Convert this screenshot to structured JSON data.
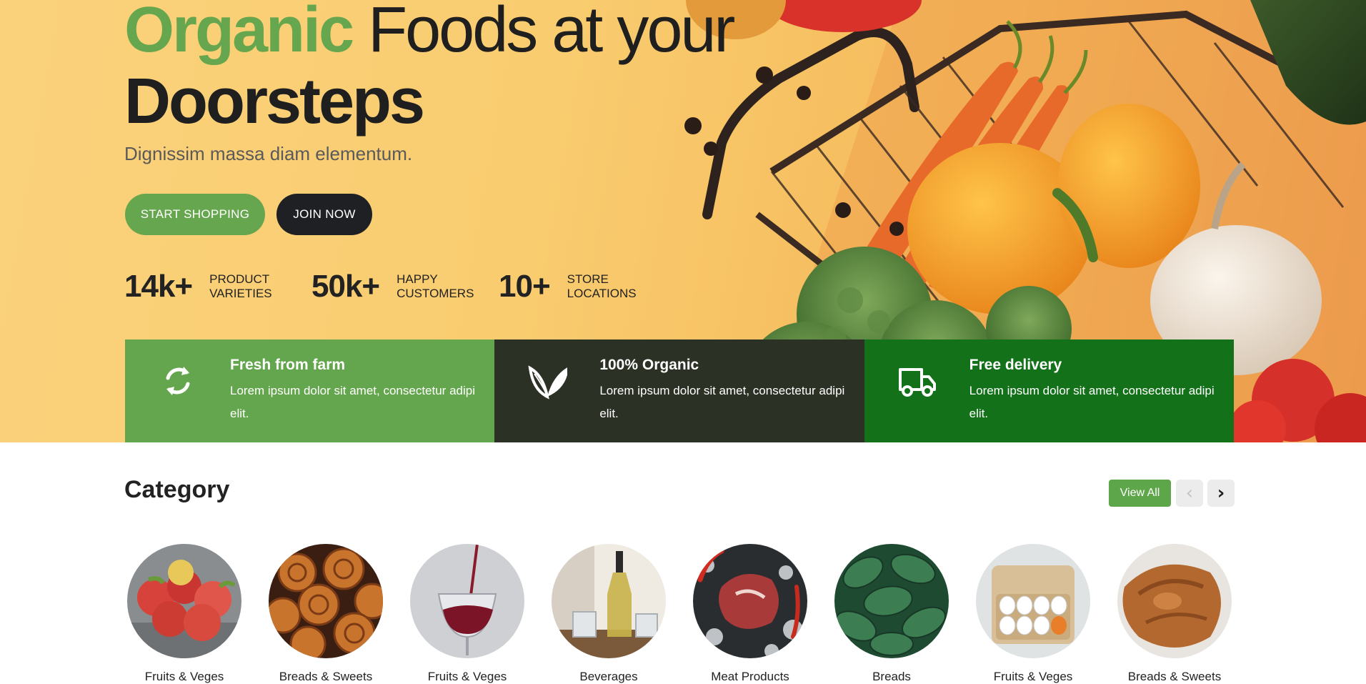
{
  "hero": {
    "title_highlight": "Organic",
    "title_rest": "Foods at your",
    "title_bold": "Doorsteps",
    "subtitle": "Dignissim massa diam elementum.",
    "btn_shop": "START SHOPPING",
    "btn_join": "JOIN NOW",
    "stats": [
      {
        "number": "14k+",
        "label_line1": "PRODUCT",
        "label_line2": "VARIETIES"
      },
      {
        "number": "50k+",
        "label_line1": "HAPPY",
        "label_line2": "CUSTOMERS"
      },
      {
        "number": "10+",
        "label_line1": "STORE",
        "label_line2": "LOCATIONS"
      }
    ]
  },
  "features": [
    {
      "icon": "refresh-icon",
      "title": "Fresh from farm",
      "text": "Lorem ipsum dolor sit amet, consectetur adipi elit.",
      "color": "#64a64d"
    },
    {
      "icon": "leaf-icon",
      "title": "100% Organic",
      "text": "Lorem ipsum dolor sit amet, consectetur adipi elit.",
      "color": "#2c3126"
    },
    {
      "icon": "truck-icon",
      "title": "Free delivery",
      "text": "Lorem ipsum dolor sit amet, consectetur adipi elit.",
      "color": "#137219"
    }
  ],
  "category": {
    "title": "Category",
    "view_all": "View All",
    "prev": "‹",
    "next": "›",
    "items": [
      {
        "label": "Fruits & Veges",
        "image": "apples"
      },
      {
        "label": "Breads & Sweets",
        "image": "cinnamon-rolls"
      },
      {
        "label": "Fruits & Veges",
        "image": "wine-glass"
      },
      {
        "label": "Beverages",
        "image": "oil-bottle"
      },
      {
        "label": "Meat Products",
        "image": "steak"
      },
      {
        "label": "Breads",
        "image": "mint-leaves"
      },
      {
        "label": "Fruits & Veges",
        "image": "eggs"
      },
      {
        "label": "Breads & Sweets",
        "image": "roast-chicken"
      }
    ]
  },
  "colors": {
    "brand_green": "#66a64e",
    "dark": "#1e2024",
    "hero_bg": "#f9cc6f"
  }
}
